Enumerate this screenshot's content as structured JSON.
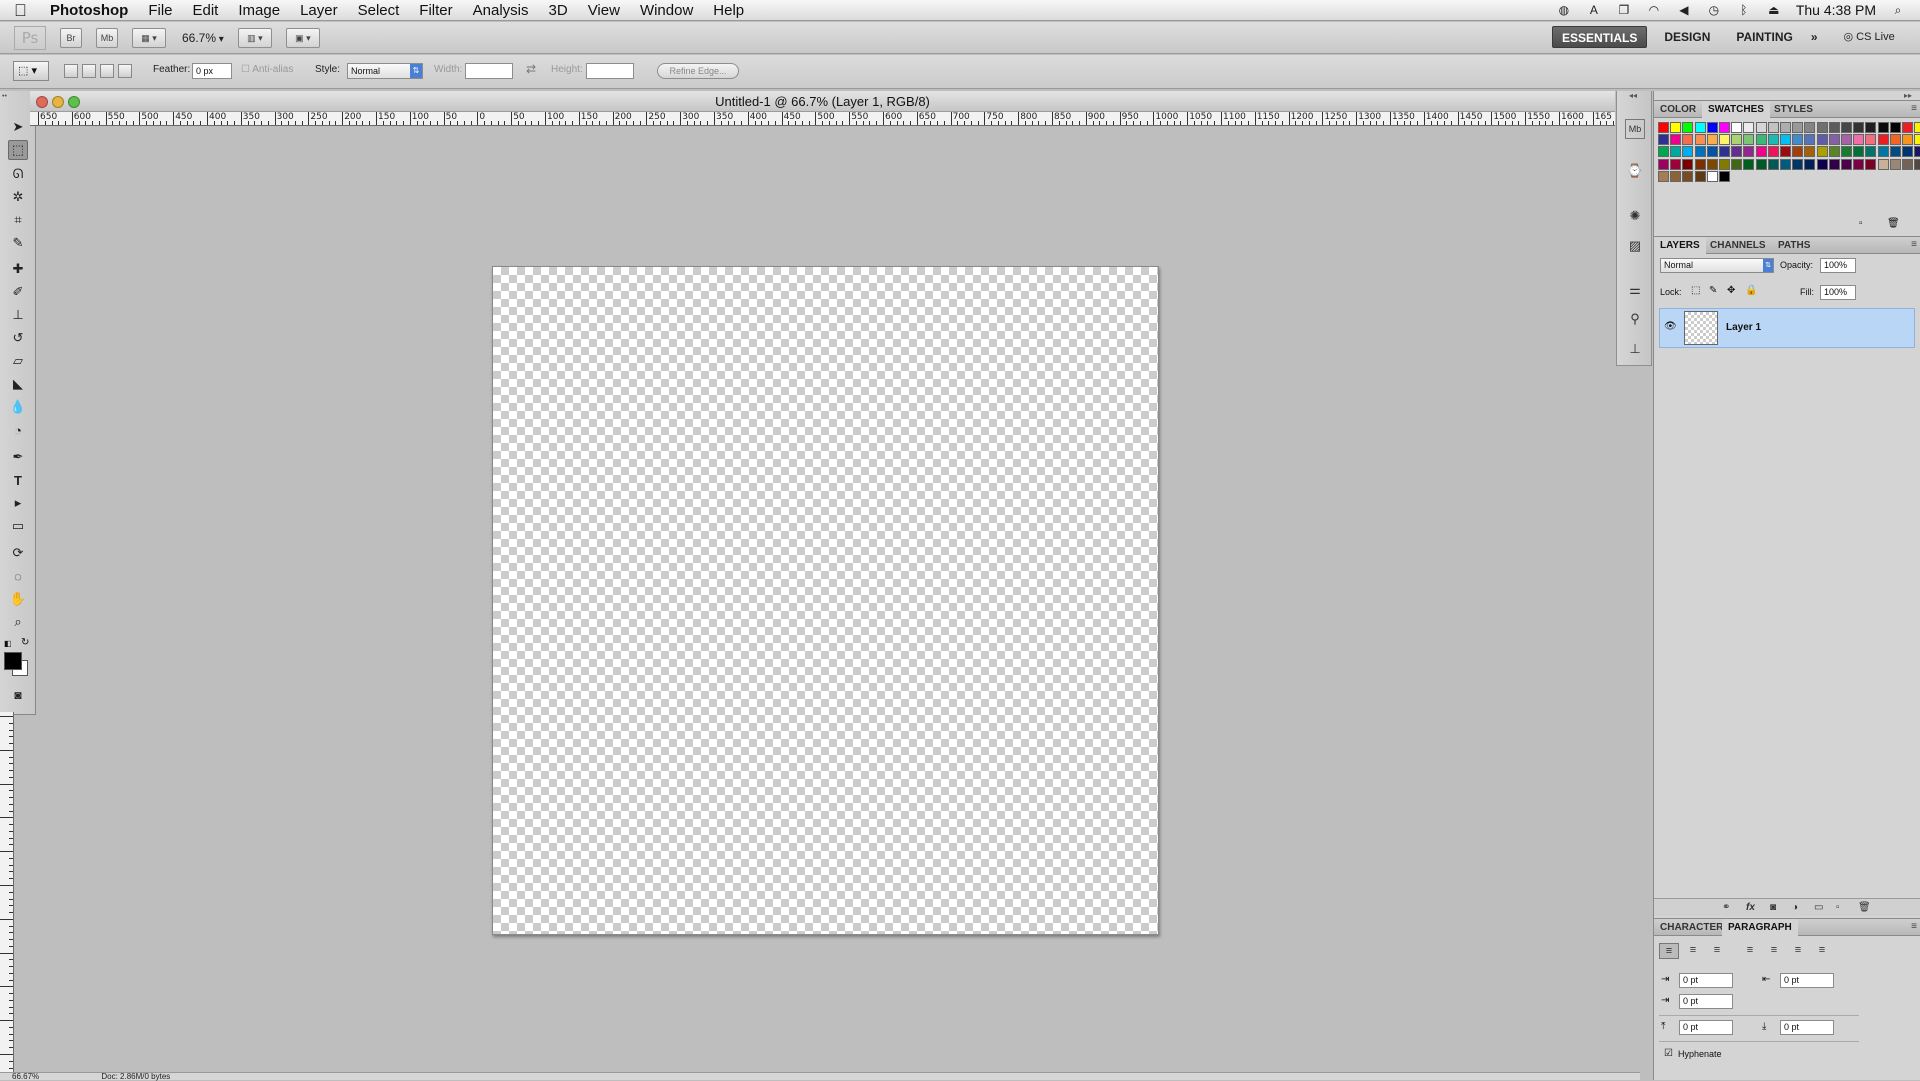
{
  "menubar": {
    "app_name": "Photoshop",
    "items": [
      "File",
      "Edit",
      "Image",
      "Layer",
      "Select",
      "Filter",
      "Analysis",
      "3D",
      "View",
      "Window",
      "Help"
    ],
    "clock": "Thu 4:38 PM",
    "status_icons": [
      "adobe-updater-icon",
      "font-icon",
      "screen-icon",
      "wifi-icon",
      "volume-icon",
      "time-machine-icon",
      "bluetooth-icon",
      "eject-icon",
      "spotlight-icon"
    ]
  },
  "appbar": {
    "logo": "Ps",
    "bridge_label": "Br",
    "minibridge_label": "Mb",
    "zoom": "66.7%",
    "workspaces": [
      "ESSENTIALS",
      "DESIGN",
      "PAINTING"
    ],
    "active_workspace": "ESSENTIALS",
    "more_label": "»",
    "cs_live": "CS Live"
  },
  "options": {
    "feather_label": "Feather:",
    "feather_value": "0 px",
    "antialias_label": "Anti-alias",
    "style_label": "Style:",
    "style_value": "Normal",
    "width_label": "Width:",
    "height_label": "Height:",
    "refine_edge": "Refine Edge..."
  },
  "document": {
    "title": "Untitled-1 @ 66.7% (Layer 1, RGB/8)",
    "ruler_labels": [
      "650",
      "600",
      "550",
      "500",
      "450",
      "400",
      "350",
      "300",
      "250",
      "200",
      "150",
      "100",
      "50",
      "0",
      "50",
      "100",
      "150",
      "200",
      "250",
      "300",
      "350",
      "400",
      "450",
      "500",
      "550",
      "600",
      "650",
      "700",
      "750",
      "800",
      "850",
      "900",
      "950",
      "1000",
      "1050",
      "1100",
      "1150",
      "1200",
      "1250",
      "1300",
      "1350",
      "1400",
      "1450",
      "1500",
      "1550",
      "1600",
      "165"
    ],
    "status_zoom": "66.67%",
    "status_doc": "Doc: 2.86M/0 bytes"
  },
  "tools": [
    "move-tool",
    "marquee-tool",
    "lasso-tool",
    "quick-select-tool",
    "crop-tool",
    "eyedropper-tool",
    "healing-brush-tool",
    "brush-tool",
    "clone-stamp-tool",
    "history-brush-tool",
    "eraser-tool",
    "paint-bucket-tool",
    "blur-tool",
    "dodge-tool",
    "pen-tool",
    "type-tool",
    "path-select-tool",
    "rectangle-tool",
    "3d-rotate-tool",
    "3d-orbit-tool",
    "hand-tool",
    "zoom-tool"
  ],
  "panels": {
    "color_tabs": [
      "COLOR",
      "SWATCHES",
      "STYLES"
    ],
    "active_color_tab": "SWATCHES",
    "layer_tabs": [
      "LAYERS",
      "CHANNELS",
      "PATHS"
    ],
    "active_layer_tab": "LAYERS",
    "blend_mode": "Normal",
    "opacity_label": "Opacity:",
    "opacity_value": "100%",
    "lock_label": "Lock:",
    "fill_label": "Fill:",
    "fill_value": "100%",
    "layers": [
      {
        "name": "Layer 1",
        "visible": true,
        "selected": true
      }
    ],
    "char_tabs": [
      "CHARACTER",
      "PARAGRAPH"
    ],
    "active_char_tab": "PARAGRAPH",
    "indent_left": "0 pt",
    "indent_right": "0 pt",
    "indent_first": "0 pt",
    "space_before": "0 pt",
    "space_after": "0 pt",
    "hyphenate_label": "Hyphenate",
    "hyphenate_checked": true
  },
  "swatch_colors": [
    [
      "#ff0000",
      "#ffff00",
      "#00ff00",
      "#00ffff",
      "#0000ff",
      "#ff00ff",
      "#ffffff",
      "#ebebeb",
      "#d6d6d6",
      "#c2c2c2",
      "#adadad",
      "#999999",
      "#858585",
      "#707070",
      "#5c5c5c",
      "#474747",
      "#333333",
      "#1f1f1f",
      "#0a0a0a",
      "#000000",
      "#ee1d24",
      "#fff200",
      "#00a650",
      "#00aeef"
    ],
    [
      "#2e3192",
      "#ec008c",
      "#f26c4f",
      "#f68e55",
      "#fbad4b",
      "#fff467",
      "#acd373",
      "#7cc576",
      "#3bb878",
      "#1abbb4",
      "#00bff3",
      "#438ccb",
      "#5574b9",
      "#605ca8",
      "#855fa8",
      "#a763a8",
      "#f06ea9",
      "#f26d7d",
      "#ed1c24",
      "#f26522",
      "#f7941d",
      "#fff200",
      "#8dc63f",
      "#39b54a"
    ],
    [
      "#00a651",
      "#00a99d",
      "#00aeef",
      "#0072bc",
      "#0054a6",
      "#2e3192",
      "#662d91",
      "#92278f",
      "#ec008c",
      "#ed145b",
      "#9e0b0f",
      "#a0410d",
      "#a3620a",
      "#aba000",
      "#598527",
      "#197b30",
      "#007236",
      "#00746b",
      "#0076a3",
      "#004b80",
      "#003471",
      "#1b1464",
      "#440e62",
      "#630460"
    ],
    [
      "#9e005d",
      "#9e0039",
      "#790000",
      "#7b2e00",
      "#7d4900",
      "#827b00",
      "#406618",
      "#005e20",
      "#005826",
      "#005952",
      "#005b7f",
      "#003663",
      "#002157",
      "#0d004c",
      "#32004b",
      "#4b0049",
      "#7b0046",
      "#7a0026",
      "#c7b299",
      "#998675",
      "#736357",
      "#534741",
      "#37302a",
      "#c69c6d"
    ],
    [
      "#a67c52",
      "#8c6239",
      "#754c24",
      "#603913",
      "#ffffff",
      "#000000",
      "#d4d4d4",
      "#d4d4d4",
      "#d4d4d4",
      "#d4d4d4",
      "#d4d4d4",
      "#d4d4d4",
      "#d4d4d4",
      "#d4d4d4",
      "#d4d4d4",
      "#d4d4d4",
      "#d4d4d4",
      "#d4d4d4",
      "#d4d4d4",
      "#d4d4d4",
      "#d4d4d4",
      "#d4d4d4",
      "#d4d4d4",
      "#d4d4d4"
    ]
  ]
}
